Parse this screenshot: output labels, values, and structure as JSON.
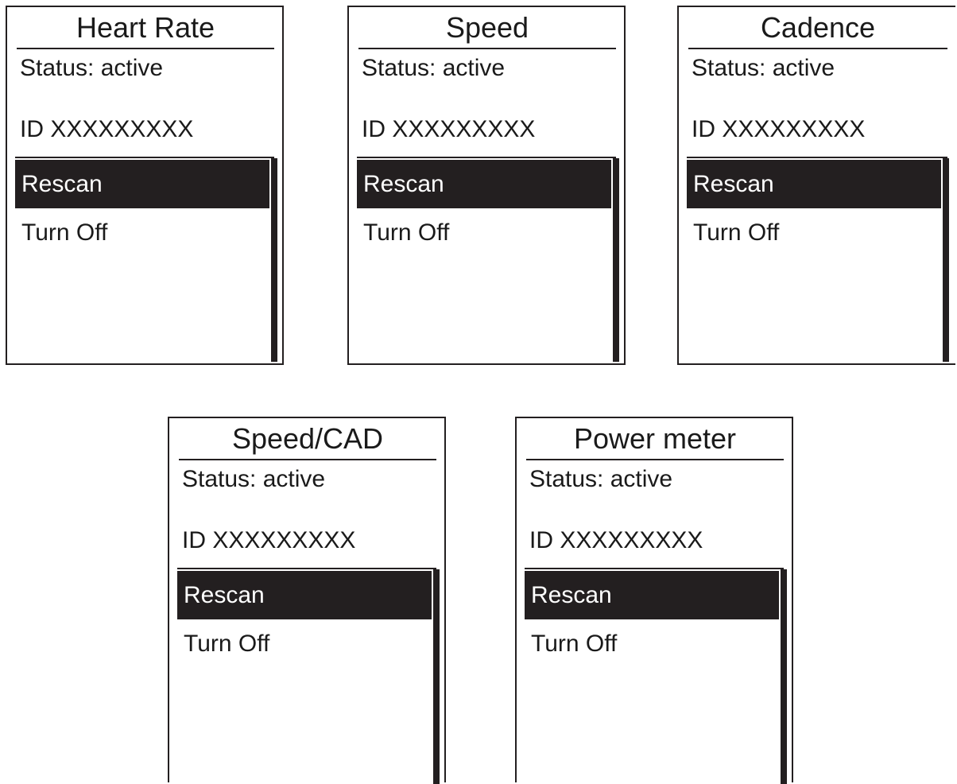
{
  "colors": {
    "ink": "#231f20",
    "background": "#ffffff",
    "highlight_text": "#ffffff"
  },
  "screens": [
    {
      "title": "Heart Rate",
      "status": "Status: active",
      "device_id": "ID XXXXXXXXX",
      "menu": [
        {
          "label": "Rescan",
          "selected": true
        },
        {
          "label": "Turn Off",
          "selected": false
        }
      ],
      "scroll_position": 0
    },
    {
      "title": "Speed",
      "status": "Status: active",
      "device_id": "ID XXXXXXXXX",
      "menu": [
        {
          "label": "Rescan",
          "selected": true
        },
        {
          "label": "Turn Off",
          "selected": false
        }
      ],
      "scroll_position": 0
    },
    {
      "title": "Cadence",
      "status": "Status: active",
      "device_id": "ID XXXXXXXXX",
      "menu": [
        {
          "label": "Rescan",
          "selected": true
        },
        {
          "label": "Turn Off",
          "selected": false
        }
      ],
      "scroll_position": 0
    },
    {
      "title": "Speed/CAD",
      "status": "Status: active",
      "device_id": "ID XXXXXXXXX",
      "menu": [
        {
          "label": "Rescan",
          "selected": true
        },
        {
          "label": "Turn Off",
          "selected": false
        }
      ],
      "scroll_position": 0
    },
    {
      "title": "Power meter",
      "status": "Status: active",
      "device_id": "ID XXXXXXXXX",
      "menu": [
        {
          "label": "Rescan",
          "selected": true
        },
        {
          "label": "Turn Off",
          "selected": false
        }
      ],
      "scroll_position": 0
    }
  ]
}
